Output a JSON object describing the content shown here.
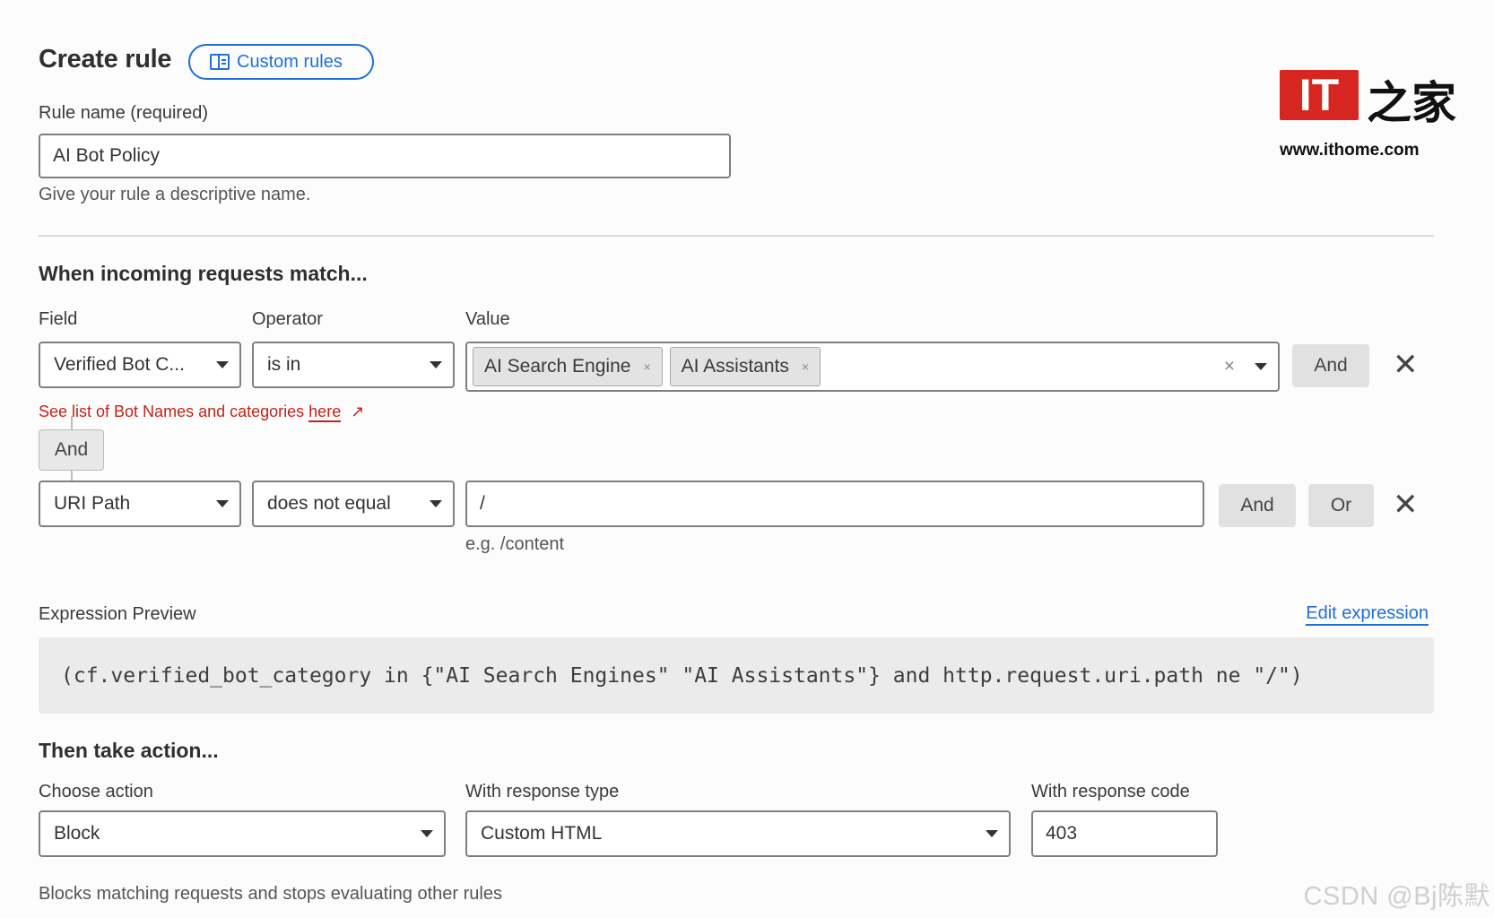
{
  "header": {
    "title": "Create rule",
    "badge_label": "Custom rules"
  },
  "rule_name": {
    "label": "Rule name (required)",
    "value": "AI Bot Policy",
    "help": "Give your rule a descriptive name."
  },
  "match": {
    "heading": "When incoming requests match...",
    "field_label": "Field",
    "operator_label": "Operator",
    "value_label": "Value",
    "row1": {
      "field": "Verified Bot C...",
      "operator": "is in",
      "tags": [
        "AI Search Engine",
        "AI Assistants"
      ],
      "and_label": "And",
      "link_text": "See list of Bot Names and categories",
      "link_here": "here"
    },
    "connector": "And",
    "row2": {
      "field": "URI Path",
      "operator": "does not equal",
      "value": "/",
      "placeholder_hint": "e.g. /content",
      "and_label": "And",
      "or_label": "Or"
    }
  },
  "expression": {
    "label": "Expression Preview",
    "edit_label": "Edit expression",
    "text": "(cf.verified_bot_category in {\"AI Search Engines\" \"AI Assistants\"} and http.request.uri.path ne \"/\")"
  },
  "action": {
    "heading": "Then take action...",
    "choose_label": "Choose action",
    "choose_value": "Block",
    "response_type_label": "With response type",
    "response_type_value": "Custom HTML",
    "response_code_label": "With response code",
    "response_code_value": "403",
    "help": "Blocks matching requests and stops evaluating other rules"
  },
  "logo": {
    "box_text": "IT",
    "chinese": "之家",
    "url": "www.ithome.com"
  },
  "watermark": "CSDN @Bj陈默",
  "icons": {
    "clear": "×",
    "remove": "✕",
    "external": "↗"
  },
  "colors": {
    "accent_blue": "#1f6fd8",
    "link_red": "#c1241a",
    "logo_red": "#d7261f"
  }
}
